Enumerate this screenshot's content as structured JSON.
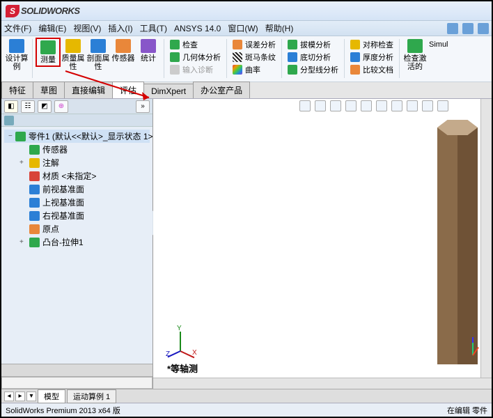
{
  "logo_text": "SOLIDWORKS",
  "menus": [
    "文件(F)",
    "编辑(E)",
    "视图(V)",
    "插入(I)",
    "工具(T)",
    "ANSYS 14.0",
    "窗口(W)",
    "帮助(H)"
  ],
  "ribbon": {
    "big": [
      {
        "label": "设计算\n例"
      },
      {
        "label": "测量"
      },
      {
        "label": "质量属\n性"
      },
      {
        "label": "剖面属\n性"
      },
      {
        "label": "传感器"
      },
      {
        "label": "统计"
      }
    ],
    "col1": [
      {
        "label": "检查",
        "cls": "ic-green"
      },
      {
        "label": "几何体分析",
        "cls": "ic-green"
      },
      {
        "label": "输入诊断",
        "cls": "ic-blue"
      }
    ],
    "col2": [
      {
        "label": "误差分析",
        "cls": "ic-orange"
      },
      {
        "label": "斑马条纹",
        "cls": "ic-stripe"
      },
      {
        "label": "曲率",
        "cls": "ic-rainbow"
      }
    ],
    "col3": [
      {
        "label": "拔模分析",
        "cls": "ic-green"
      },
      {
        "label": "底切分析",
        "cls": "ic-blue"
      },
      {
        "label": "分型线分析",
        "cls": "ic-green"
      }
    ],
    "col4": [
      {
        "label": "对称检查",
        "cls": "ic-yellow"
      },
      {
        "label": "厚度分析",
        "cls": "ic-blue"
      },
      {
        "label": "比较文档",
        "cls": "ic-orange"
      }
    ],
    "col5": [
      {
        "label": "检查激\n活的"
      }
    ],
    "simul": "Simul"
  },
  "rtab": [
    "特征",
    "草图",
    "直接编辑",
    "评估",
    "DimXpert",
    "办公室产品"
  ],
  "tree_root": "零件1 (默认<<默认>_显示状态 1>",
  "tree_items": [
    {
      "label": "传感器",
      "cls": "ic-green",
      "exp": ""
    },
    {
      "label": "注解",
      "cls": "ic-yellow",
      "exp": "+"
    },
    {
      "label": "材质 <未指定>",
      "cls": "ic-red",
      "exp": ""
    },
    {
      "label": "前视基准面",
      "cls": "ic-blue",
      "exp": ""
    },
    {
      "label": "上视基准面",
      "cls": "ic-blue",
      "exp": ""
    },
    {
      "label": "右视基准面",
      "cls": "ic-blue",
      "exp": ""
    },
    {
      "label": "原点",
      "cls": "ic-orange",
      "exp": ""
    },
    {
      "label": "凸台-拉伸1",
      "cls": "ic-green",
      "exp": "+"
    }
  ],
  "view_label": "*等轴测",
  "bottom_tabs": [
    "模型",
    "运动算例 1"
  ],
  "status_left": "SolidWorks Premium 2013 x64 版",
  "status_right": "在编辑 零件"
}
